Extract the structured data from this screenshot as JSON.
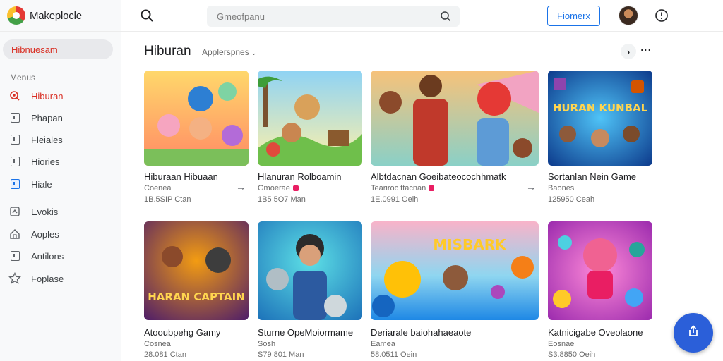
{
  "app": {
    "name": "Makeplocle"
  },
  "sidebar": {
    "active_label": "Hibnuesam",
    "section_label": "Menus",
    "items": [
      {
        "label": "Hiburan",
        "icon": "discover-icon",
        "active": true
      },
      {
        "label": "Phapan",
        "icon": "apps-icon",
        "active": false
      },
      {
        "label": "Fleiales",
        "icon": "files-icon",
        "active": false
      },
      {
        "label": "Hiories",
        "icon": "library-icon",
        "active": false
      },
      {
        "label": "Hiale",
        "icon": "bookmark-icon",
        "active": false
      },
      {
        "label": "Evokis",
        "icon": "gamepad-icon",
        "active": false
      },
      {
        "label": "Aoples",
        "icon": "home-icon",
        "active": false
      },
      {
        "label": "Antilons",
        "icon": "news-icon",
        "active": false
      },
      {
        "label": "Foplase",
        "icon": "star-icon",
        "active": false
      }
    ]
  },
  "topbar": {
    "search_placeholder": "Gmeofpanu",
    "button_label": "Fiomerx"
  },
  "main": {
    "title": "Hiburan",
    "subtitle": "Applerspnes",
    "cards": [
      {
        "title": "Hiburaan Hibuaan",
        "category": "Coenea",
        "meta": "1B.5SIP Ctan",
        "badge": false,
        "arrow": true
      },
      {
        "title": "Hlanuran Rolboamin",
        "category": "Gmoerae",
        "meta": "1B5 5O7 Man",
        "badge": true,
        "arrow": false
      },
      {
        "title": "Albtdacnan Goeibateocochhmatk",
        "category": "Teariroc ttacnan",
        "meta": "1E.0991 Oeih",
        "badge": true,
        "arrow": true
      },
      {
        "title": "Sortanlan Nein Game",
        "category": "Baones",
        "meta": "125950 Ceah",
        "badge": false,
        "arrow": false
      },
      {
        "title": "Atooubpehg Gamy",
        "category": "Cosnea",
        "meta": "28.081 Ctan",
        "badge": false,
        "arrow": false
      },
      {
        "title": "Sturne OpeMoiormame",
        "category": "Sosh",
        "meta": "S79 801 Man",
        "badge": false,
        "arrow": false
      },
      {
        "title": "Deriarale baiohahaeaote",
        "category": "Eamea",
        "meta": "58.0511 Oein",
        "badge": false,
        "arrow": false
      },
      {
        "title": "Katnicigabe Oveolaone",
        "category": "Eosnae",
        "meta": "S3.8850 Oeih",
        "badge": false,
        "arrow": false
      }
    ],
    "thumb_texts": [
      "",
      "",
      "",
      "HURAN KUNBAL",
      "HARAN CAPTAIN",
      "",
      "MISBARK",
      ""
    ]
  },
  "colors": {
    "accent_red": "#d93025",
    "accent_blue": "#1a73e8",
    "fab": "#2b5fd9"
  }
}
